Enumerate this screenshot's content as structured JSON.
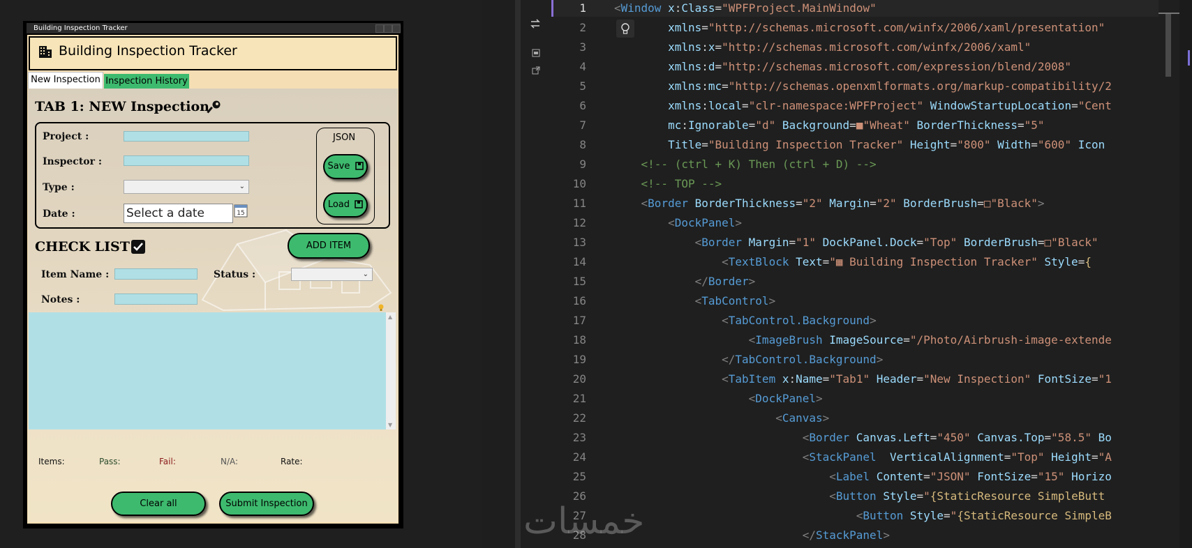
{
  "app": {
    "window_title": "Building Inspection Tracker",
    "header_title": "Building Inspection Tracker",
    "tabs": [
      {
        "label": "New Inspection"
      },
      {
        "label": "Inspection History"
      }
    ],
    "section1_title": "TAB 1: NEW Inspection",
    "form": {
      "project_label": "Project :",
      "inspector_label": "Inspector :",
      "type_label": "Type :",
      "date_label": "Date :",
      "date_placeholder": "Select a date",
      "calendar_day": "15"
    },
    "json_panel": {
      "label": "JSON",
      "save_label": "Save",
      "load_label": "Load"
    },
    "section2_title": "CHECK LIST",
    "add_item_label": "ADD ITEM",
    "checklist_form": {
      "item_name_label": "Item Name :",
      "status_label": "Status :",
      "notes_label": "Notes :"
    },
    "stats": {
      "items_label": "Items:",
      "pass_label": "Pass:",
      "fail_label": "Fail:",
      "na_label": "N/A:",
      "rate_label": "Rate:"
    },
    "buttons": {
      "clear_label": "Clear all",
      "submit_label": "Submit Inspection"
    },
    "colors": {
      "accent_green": "#3dba6e",
      "input_blue": "#b0e0e6",
      "wheat": "#f5deb3"
    }
  },
  "editor": {
    "lines": [
      {
        "n": "1",
        "segments": [
          {
            "c": "t-br",
            "t": "<"
          },
          {
            "c": "t-tag",
            "t": "Window "
          },
          {
            "c": "t-attr",
            "t": "x"
          },
          {
            "c": "t-w",
            "t": ":"
          },
          {
            "c": "t-attr",
            "t": "Class"
          },
          {
            "c": "t-w",
            "t": "="
          },
          {
            "c": "t-str",
            "t": "\"WPFProject.MainWindow\""
          }
        ]
      },
      {
        "n": "2",
        "segments": [
          {
            "c": "t-w",
            "t": "        "
          },
          {
            "c": "t-attr",
            "t": "xmlns"
          },
          {
            "c": "t-w",
            "t": "="
          },
          {
            "c": "t-str",
            "t": "\"http://schemas.microsoft.com/winfx/2006/xaml/presentation\""
          }
        ]
      },
      {
        "n": "3",
        "segments": [
          {
            "c": "t-w",
            "t": "        "
          },
          {
            "c": "t-attr",
            "t": "xmlns"
          },
          {
            "c": "t-w",
            "t": ":"
          },
          {
            "c": "t-attr",
            "t": "x"
          },
          {
            "c": "t-w",
            "t": "="
          },
          {
            "c": "t-str",
            "t": "\"http://schemas.microsoft.com/winfx/2006/xaml\""
          }
        ]
      },
      {
        "n": "4",
        "segments": [
          {
            "c": "t-w",
            "t": "        "
          },
          {
            "c": "t-attr",
            "t": "xmlns"
          },
          {
            "c": "t-w",
            "t": ":"
          },
          {
            "c": "t-attr",
            "t": "d"
          },
          {
            "c": "t-w",
            "t": "="
          },
          {
            "c": "t-str",
            "t": "\"http://schemas.microsoft.com/expression/blend/2008\""
          }
        ]
      },
      {
        "n": "5",
        "segments": [
          {
            "c": "t-w",
            "t": "        "
          },
          {
            "c": "t-attr",
            "t": "xmlns"
          },
          {
            "c": "t-w",
            "t": ":"
          },
          {
            "c": "t-attr",
            "t": "mc"
          },
          {
            "c": "t-w",
            "t": "="
          },
          {
            "c": "t-str",
            "t": "\"http://schemas.openxmlformats.org/markup-compatibility/2"
          }
        ]
      },
      {
        "n": "6",
        "segments": [
          {
            "c": "t-w",
            "t": "        "
          },
          {
            "c": "t-attr",
            "t": "xmlns"
          },
          {
            "c": "t-w",
            "t": ":"
          },
          {
            "c": "t-attr",
            "t": "local"
          },
          {
            "c": "t-w",
            "t": "="
          },
          {
            "c": "t-str",
            "t": "\"clr-namespace:WPFProject\" "
          },
          {
            "c": "t-attr",
            "t": "WindowStartupLocation"
          },
          {
            "c": "t-w",
            "t": "="
          },
          {
            "c": "t-str",
            "t": "\"Cent"
          }
        ]
      },
      {
        "n": "7",
        "segments": [
          {
            "c": "t-w",
            "t": "        "
          },
          {
            "c": "t-attr",
            "t": "mc"
          },
          {
            "c": "t-w",
            "t": ":"
          },
          {
            "c": "t-attr",
            "t": "Ignorable"
          },
          {
            "c": "t-w",
            "t": "="
          },
          {
            "c": "t-str",
            "t": "\"d\" "
          },
          {
            "c": "t-attr",
            "t": "Background"
          },
          {
            "c": "t-w",
            "t": "="
          },
          {
            "c": "t-str",
            "t": "■\"Wheat\" "
          },
          {
            "c": "t-attr",
            "t": "BorderThickness"
          },
          {
            "c": "t-w",
            "t": "="
          },
          {
            "c": "t-str",
            "t": "\"5\""
          }
        ]
      },
      {
        "n": "8",
        "segments": [
          {
            "c": "t-w",
            "t": "        "
          },
          {
            "c": "t-attr",
            "t": "Title"
          },
          {
            "c": "t-w",
            "t": "="
          },
          {
            "c": "t-str",
            "t": "\"Building Inspection Tracker\" "
          },
          {
            "c": "t-attr",
            "t": "Height"
          },
          {
            "c": "t-w",
            "t": "="
          },
          {
            "c": "t-str",
            "t": "\"800\" "
          },
          {
            "c": "t-attr",
            "t": "Width"
          },
          {
            "c": "t-w",
            "t": "="
          },
          {
            "c": "t-str",
            "t": "\"600\" "
          },
          {
            "c": "t-attr",
            "t": "Icon"
          }
        ]
      },
      {
        "n": "9",
        "segments": [
          {
            "c": "t-w",
            "t": "    "
          },
          {
            "c": "t-com",
            "t": "<!-- (ctrl + K) Then (ctrl + D) -->"
          }
        ]
      },
      {
        "n": "10",
        "segments": [
          {
            "c": "t-w",
            "t": "    "
          },
          {
            "c": "t-com",
            "t": "<!-- TOP -->"
          }
        ]
      },
      {
        "n": "11",
        "segments": [
          {
            "c": "t-w",
            "t": "    "
          },
          {
            "c": "t-br",
            "t": "<"
          },
          {
            "c": "t-tag",
            "t": "Border "
          },
          {
            "c": "t-attr",
            "t": "BorderThickness"
          },
          {
            "c": "t-w",
            "t": "="
          },
          {
            "c": "t-str",
            "t": "\"2\" "
          },
          {
            "c": "t-attr",
            "t": "Margin"
          },
          {
            "c": "t-w",
            "t": "="
          },
          {
            "c": "t-str",
            "t": "\"2\" "
          },
          {
            "c": "t-attr",
            "t": "BorderBrush"
          },
          {
            "c": "t-w",
            "t": "="
          },
          {
            "c": "t-str",
            "t": "□\"Black\""
          },
          {
            "c": "t-br",
            "t": ">"
          }
        ]
      },
      {
        "n": "12",
        "segments": [
          {
            "c": "t-w",
            "t": "        "
          },
          {
            "c": "t-br",
            "t": "<"
          },
          {
            "c": "t-tag",
            "t": "DockPanel"
          },
          {
            "c": "t-br",
            "t": ">"
          }
        ]
      },
      {
        "n": "13",
        "segments": [
          {
            "c": "t-w",
            "t": "            "
          },
          {
            "c": "t-br",
            "t": "<"
          },
          {
            "c": "t-tag",
            "t": "Border "
          },
          {
            "c": "t-attr",
            "t": "Margin"
          },
          {
            "c": "t-w",
            "t": "="
          },
          {
            "c": "t-str",
            "t": "\"1\" "
          },
          {
            "c": "t-attr",
            "t": "DockPanel.Dock"
          },
          {
            "c": "t-w",
            "t": "="
          },
          {
            "c": "t-str",
            "t": "\"Top\" "
          },
          {
            "c": "t-attr",
            "t": "BorderBrush"
          },
          {
            "c": "t-w",
            "t": "="
          },
          {
            "c": "t-str",
            "t": "□\"Black\""
          }
        ]
      },
      {
        "n": "14",
        "segments": [
          {
            "c": "t-w",
            "t": "                "
          },
          {
            "c": "t-br",
            "t": "<"
          },
          {
            "c": "t-tag",
            "t": "TextBlock "
          },
          {
            "c": "t-attr",
            "t": "Text"
          },
          {
            "c": "t-w",
            "t": "="
          },
          {
            "c": "t-str",
            "t": "\"▦ Building Inspection Tracker\" "
          },
          {
            "c": "t-attr",
            "t": "Style"
          },
          {
            "c": "t-w",
            "t": "="
          },
          {
            "c": "t-acc",
            "t": "{"
          }
        ]
      },
      {
        "n": "15",
        "segments": [
          {
            "c": "t-w",
            "t": "            "
          },
          {
            "c": "t-br",
            "t": "</"
          },
          {
            "c": "t-tag",
            "t": "Border"
          },
          {
            "c": "t-br",
            "t": ">"
          }
        ]
      },
      {
        "n": "16",
        "segments": [
          {
            "c": "t-w",
            "t": "            "
          },
          {
            "c": "t-br",
            "t": "<"
          },
          {
            "c": "t-tag",
            "t": "TabControl"
          },
          {
            "c": "t-br",
            "t": ">"
          }
        ]
      },
      {
        "n": "17",
        "segments": [
          {
            "c": "t-w",
            "t": "                "
          },
          {
            "c": "t-br",
            "t": "<"
          },
          {
            "c": "t-tag",
            "t": "TabControl.Background"
          },
          {
            "c": "t-br",
            "t": ">"
          }
        ]
      },
      {
        "n": "18",
        "segments": [
          {
            "c": "t-w",
            "t": "                    "
          },
          {
            "c": "t-br",
            "t": "<"
          },
          {
            "c": "t-tag",
            "t": "ImageBrush "
          },
          {
            "c": "t-attr",
            "t": "ImageSource"
          },
          {
            "c": "t-w",
            "t": "="
          },
          {
            "c": "t-str",
            "t": "\"/Photo/Airbrush-image-extende"
          }
        ]
      },
      {
        "n": "19",
        "segments": [
          {
            "c": "t-w",
            "t": "                "
          },
          {
            "c": "t-br",
            "t": "</"
          },
          {
            "c": "t-tag",
            "t": "TabControl.Background"
          },
          {
            "c": "t-br",
            "t": ">"
          }
        ]
      },
      {
        "n": "20",
        "segments": [
          {
            "c": "t-w",
            "t": "                "
          },
          {
            "c": "t-br",
            "t": "<"
          },
          {
            "c": "t-tag",
            "t": "TabItem "
          },
          {
            "c": "t-attr",
            "t": "x"
          },
          {
            "c": "t-w",
            "t": ":"
          },
          {
            "c": "t-attr",
            "t": "Name"
          },
          {
            "c": "t-w",
            "t": "="
          },
          {
            "c": "t-str",
            "t": "\"Tab1\" "
          },
          {
            "c": "t-attr",
            "t": "Header"
          },
          {
            "c": "t-w",
            "t": "="
          },
          {
            "c": "t-str",
            "t": "\"New Inspection\" "
          },
          {
            "c": "t-attr",
            "t": "FontSize"
          },
          {
            "c": "t-w",
            "t": "="
          },
          {
            "c": "t-str",
            "t": "\"1"
          }
        ]
      },
      {
        "n": "21",
        "segments": [
          {
            "c": "t-w",
            "t": "                    "
          },
          {
            "c": "t-br",
            "t": "<"
          },
          {
            "c": "t-tag",
            "t": "DockPanel"
          },
          {
            "c": "t-br",
            "t": ">"
          }
        ]
      },
      {
        "n": "22",
        "segments": [
          {
            "c": "t-w",
            "t": "                        "
          },
          {
            "c": "t-br",
            "t": "<"
          },
          {
            "c": "t-tag",
            "t": "Canvas"
          },
          {
            "c": "t-br",
            "t": ">"
          }
        ]
      },
      {
        "n": "23",
        "segments": [
          {
            "c": "t-w",
            "t": "                            "
          },
          {
            "c": "t-br",
            "t": "<"
          },
          {
            "c": "t-tag",
            "t": "Border "
          },
          {
            "c": "t-attr",
            "t": "Canvas.Left"
          },
          {
            "c": "t-w",
            "t": "="
          },
          {
            "c": "t-str",
            "t": "\"450\" "
          },
          {
            "c": "t-attr",
            "t": "Canvas.Top"
          },
          {
            "c": "t-w",
            "t": "="
          },
          {
            "c": "t-str",
            "t": "\"58.5\" "
          },
          {
            "c": "t-attr",
            "t": "Bo"
          }
        ]
      },
      {
        "n": "24",
        "segments": [
          {
            "c": "t-w",
            "t": "                            "
          },
          {
            "c": "t-br",
            "t": "<"
          },
          {
            "c": "t-tag",
            "t": "StackPanel  "
          },
          {
            "c": "t-attr",
            "t": "VerticalAlignment"
          },
          {
            "c": "t-w",
            "t": "="
          },
          {
            "c": "t-str",
            "t": "\"Top\" "
          },
          {
            "c": "t-attr",
            "t": "Height"
          },
          {
            "c": "t-w",
            "t": "="
          },
          {
            "c": "t-str",
            "t": "\"A"
          }
        ]
      },
      {
        "n": "25",
        "segments": [
          {
            "c": "t-w",
            "t": "                                "
          },
          {
            "c": "t-br",
            "t": "<"
          },
          {
            "c": "t-tag",
            "t": "Label "
          },
          {
            "c": "t-attr",
            "t": "Content"
          },
          {
            "c": "t-w",
            "t": "="
          },
          {
            "c": "t-str",
            "t": "\"JSON\" "
          },
          {
            "c": "t-attr",
            "t": "FontSize"
          },
          {
            "c": "t-w",
            "t": "="
          },
          {
            "c": "t-str",
            "t": "\"15\" "
          },
          {
            "c": "t-attr",
            "t": "Horizo"
          }
        ]
      },
      {
        "n": "26",
        "segments": [
          {
            "c": "t-w",
            "t": "                                "
          },
          {
            "c": "t-br",
            "t": "<"
          },
          {
            "c": "t-tag",
            "t": "Button "
          },
          {
            "c": "t-attr",
            "t": "Style"
          },
          {
            "c": "t-w",
            "t": "="
          },
          {
            "c": "t-str",
            "t": "\""
          },
          {
            "c": "t-acc",
            "t": "{StaticResource SimpleButt"
          }
        ]
      },
      {
        "n": "27",
        "segments": [
          {
            "c": "t-w",
            "t": "                                    "
          },
          {
            "c": "t-br",
            "t": "<"
          },
          {
            "c": "t-tag",
            "t": "Button "
          },
          {
            "c": "t-attr",
            "t": "Style"
          },
          {
            "c": "t-w",
            "t": "="
          },
          {
            "c": "t-str",
            "t": "\""
          },
          {
            "c": "t-acc",
            "t": "{StaticResource SimpleB"
          }
        ]
      },
      {
        "n": "28",
        "segments": [
          {
            "c": "t-w",
            "t": "                            "
          },
          {
            "c": "t-br",
            "t": "</"
          },
          {
            "c": "t-tag",
            "t": "StackPanel"
          },
          {
            "c": "t-br",
            "t": ">"
          }
        ]
      }
    ]
  },
  "watermark": "خمسات"
}
